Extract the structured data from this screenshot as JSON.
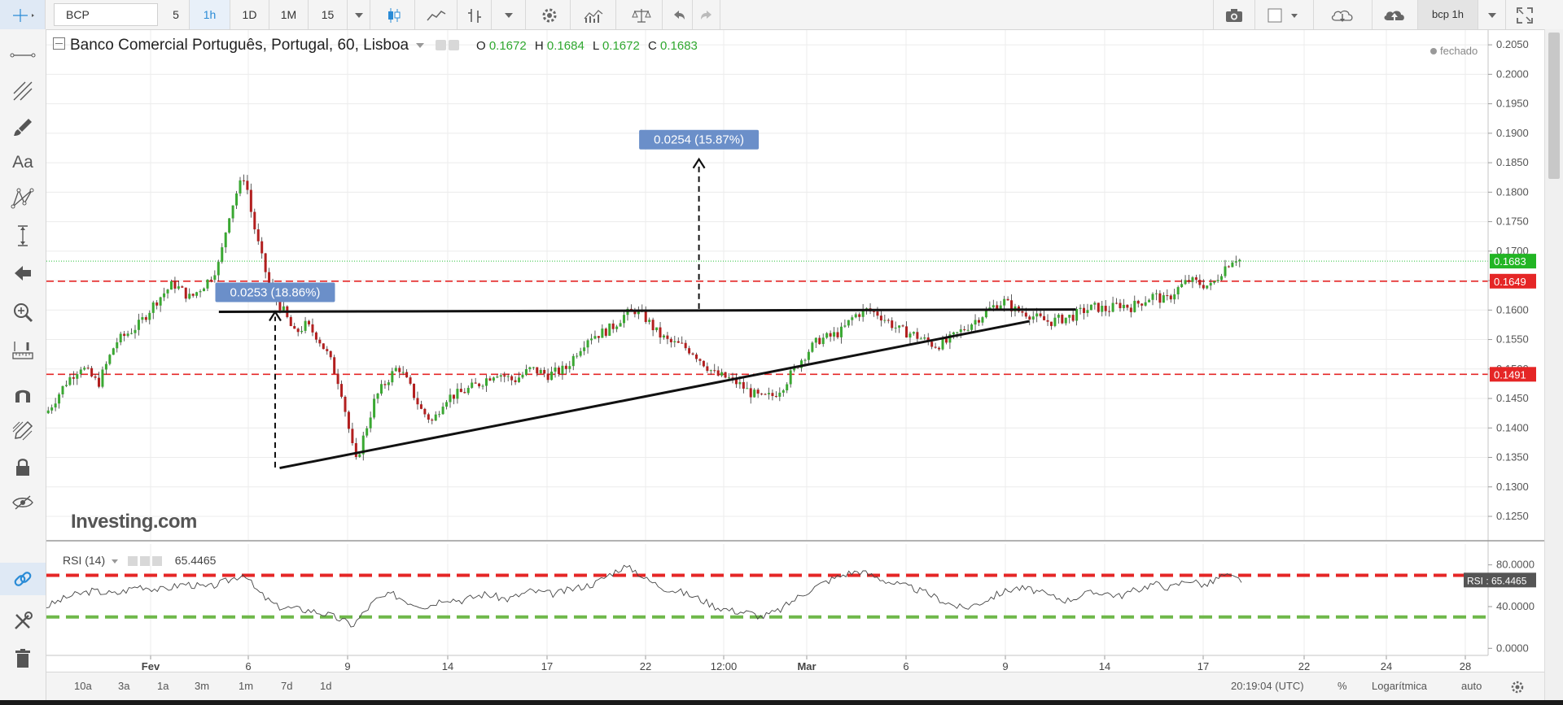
{
  "toolbar": {
    "symbol": "BCP",
    "intervals": [
      "5",
      "1h",
      "1D",
      "1M",
      "15"
    ],
    "active_interval": "1h",
    "layout_label": "bcp 1h"
  },
  "legend": {
    "title": "Banco Comercial Português, Portugal, 60, Lisboa",
    "o_label": "O",
    "o_value": "0.1672",
    "h_label": "H",
    "h_value": "0.1684",
    "l_label": "L",
    "l_value": "0.1672",
    "c_label": "C",
    "c_value": "0.1683",
    "status": "fechado",
    "watermark": "Investing.com"
  },
  "rsi": {
    "label": "RSI (14)",
    "value": "65.4465",
    "badge": "RSI : 65.4465"
  },
  "bottombar": {
    "ranges": [
      "10a",
      "3a",
      "1a",
      "3m",
      "1m",
      "7d",
      "1d"
    ],
    "time": "20:19:04",
    "tz": "(UTC)",
    "pct": "%",
    "log": "Logarítmica",
    "auto": "auto"
  },
  "colors": {
    "up": "#3aa832",
    "down": "#b21f1f",
    "price_line": "#29c13a",
    "resistance": "#e52626",
    "rsi_upper": "#e52626",
    "rsi_lower": "#6fb84a",
    "annotation_bg": "#6b8fc9"
  },
  "chart_data": {
    "type": "candlestick",
    "instrument": "Banco Comercial Português, Portugal, 60, Lisboa",
    "y_ticks": [
      "0.2050",
      "0.2000",
      "0.1950",
      "0.1900",
      "0.1850",
      "0.1800",
      "0.1750",
      "0.1700",
      "0.1650",
      "0.1600",
      "0.1550",
      "0.1500",
      "0.1450",
      "0.1400",
      "0.1350",
      "0.1300",
      "0.1250"
    ],
    "ylim": [
      0.121,
      0.2075
    ],
    "x_ticks": [
      "Fev",
      "6",
      "9",
      "14",
      "17",
      "22",
      "12:00",
      "Mar",
      "6",
      "9",
      "14",
      "17",
      "22",
      "24",
      "28"
    ],
    "last_price": "0.1683",
    "horizontal_levels": [
      {
        "label": "0.1649",
        "value": 0.1649
      },
      {
        "label": "0.1491",
        "value": 0.1491
      }
    ],
    "trendlines": [
      {
        "name": "resistance",
        "x1": 0.1495,
        "y1": 0.1597,
        "x2": 0.8925,
        "y2": 0.1601
      },
      {
        "name": "support",
        "x1": 0.2022,
        "y1": 0.1332,
        "x2": 0.852,
        "y2": 0.1581
      }
    ],
    "measures": [
      {
        "label": "0.0253 (18.86%)",
        "x": 0.1983,
        "from": 0.1333,
        "to": 0.1597
      },
      {
        "label": "0.0254 (15.87%)",
        "x": 0.5657,
        "from": 0.1602,
        "to": 0.1856
      }
    ],
    "price_path": [
      [
        0.0,
        0.1425
      ],
      [
        0.018,
        0.148
      ],
      [
        0.03,
        0.1505
      ],
      [
        0.045,
        0.1475
      ],
      [
        0.06,
        0.1545
      ],
      [
        0.08,
        0.1575
      ],
      [
        0.095,
        0.1615
      ],
      [
        0.11,
        0.1645
      ],
      [
        0.125,
        0.162
      ],
      [
        0.14,
        0.165
      ],
      [
        0.15,
        0.168
      ],
      [
        0.158,
        0.176
      ],
      [
        0.165,
        0.18
      ],
      [
        0.172,
        0.183
      ],
      [
        0.178,
        0.176
      ],
      [
        0.185,
        0.17
      ],
      [
        0.195,
        0.163
      ],
      [
        0.205,
        0.16
      ],
      [
        0.215,
        0.156
      ],
      [
        0.225,
        0.1575
      ],
      [
        0.235,
        0.1555
      ],
      [
        0.245,
        0.152
      ],
      [
        0.255,
        0.147
      ],
      [
        0.262,
        0.14
      ],
      [
        0.268,
        0.134
      ],
      [
        0.275,
        0.1385
      ],
      [
        0.285,
        0.145
      ],
      [
        0.295,
        0.148
      ],
      [
        0.305,
        0.1505
      ],
      [
        0.315,
        0.147
      ],
      [
        0.325,
        0.143
      ],
      [
        0.335,
        0.141
      ],
      [
        0.345,
        0.145
      ],
      [
        0.36,
        0.146
      ],
      [
        0.375,
        0.1475
      ],
      [
        0.39,
        0.1495
      ],
      [
        0.405,
        0.148
      ],
      [
        0.42,
        0.15
      ],
      [
        0.435,
        0.149
      ],
      [
        0.45,
        0.15
      ],
      [
        0.46,
        0.153
      ],
      [
        0.47,
        0.1555
      ],
      [
        0.48,
        0.156
      ],
      [
        0.49,
        0.157
      ],
      [
        0.5,
        0.159
      ],
      [
        0.51,
        0.16
      ],
      [
        0.52,
        0.1585
      ],
      [
        0.53,
        0.156
      ],
      [
        0.54,
        0.1545
      ],
      [
        0.55,
        0.154
      ],
      [
        0.56,
        0.153
      ],
      [
        0.57,
        0.151
      ],
      [
        0.58,
        0.149
      ],
      [
        0.59,
        0.1485
      ],
      [
        0.6,
        0.1475
      ],
      [
        0.61,
        0.146
      ],
      [
        0.62,
        0.145
      ],
      [
        0.63,
        0.1455
      ],
      [
        0.64,
        0.1475
      ],
      [
        0.65,
        0.1505
      ],
      [
        0.66,
        0.153
      ],
      [
        0.67,
        0.155
      ],
      [
        0.68,
        0.1555
      ],
      [
        0.69,
        0.1565
      ],
      [
        0.7,
        0.159
      ],
      [
        0.71,
        0.16
      ],
      [
        0.72,
        0.1595
      ],
      [
        0.73,
        0.158
      ],
      [
        0.74,
        0.1565
      ],
      [
        0.75,
        0.156
      ],
      [
        0.76,
        0.155
      ],
      [
        0.77,
        0.154
      ],
      [
        0.78,
        0.1545
      ],
      [
        0.79,
        0.156
      ],
      [
        0.8,
        0.1575
      ],
      [
        0.81,
        0.159
      ],
      [
        0.82,
        0.1605
      ],
      [
        0.83,
        0.1615
      ],
      [
        0.84,
        0.16
      ],
      [
        0.85,
        0.1595
      ],
      [
        0.86,
        0.1585
      ],
      [
        0.87,
        0.158
      ],
      [
        0.88,
        0.1585
      ],
      [
        0.89,
        0.159
      ],
      [
        0.9,
        0.16
      ],
      [
        0.91,
        0.1605
      ],
      [
        0.92,
        0.16
      ],
      [
        0.93,
        0.161
      ],
      [
        0.94,
        0.1605
      ],
      [
        0.95,
        0.1615
      ],
      [
        0.96,
        0.1625
      ],
      [
        0.97,
        0.1615
      ],
      [
        0.98,
        0.1635
      ],
      [
        0.99,
        0.165
      ],
      [
        1.0,
        0.1645
      ],
      [
        1.01,
        0.164
      ],
      [
        1.02,
        0.167
      ],
      [
        1.03,
        0.169
      ],
      [
        1.036,
        0.1683
      ]
    ],
    "rsi_series": {
      "name": "RSI (14)",
      "ticks": [
        "80.0000",
        "40.0000",
        "0.0000"
      ],
      "ylim": [
        -6,
        100
      ],
      "upper_band": 70,
      "lower_band": 30,
      "last": "65.4465",
      "points": [
        [
          0.0,
          40
        ],
        [
          0.02,
          50
        ],
        [
          0.04,
          55
        ],
        [
          0.06,
          52
        ],
        [
          0.08,
          60
        ],
        [
          0.1,
          56
        ],
        [
          0.12,
          62
        ],
        [
          0.14,
          58
        ],
        [
          0.16,
          66
        ],
        [
          0.172,
          72
        ],
        [
          0.18,
          58
        ],
        [
          0.19,
          48
        ],
        [
          0.2,
          40
        ],
        [
          0.215,
          38
        ],
        [
          0.23,
          36
        ],
        [
          0.245,
          32
        ],
        [
          0.258,
          26
        ],
        [
          0.266,
          22
        ],
        [
          0.275,
          34
        ],
        [
          0.285,
          46
        ],
        [
          0.3,
          52
        ],
        [
          0.315,
          44
        ],
        [
          0.33,
          40
        ],
        [
          0.345,
          48
        ],
        [
          0.36,
          46
        ],
        [
          0.38,
          52
        ],
        [
          0.4,
          47
        ],
        [
          0.42,
          55
        ],
        [
          0.44,
          52
        ],
        [
          0.46,
          58
        ],
        [
          0.475,
          62
        ],
        [
          0.49,
          72
        ],
        [
          0.5,
          78
        ],
        [
          0.51,
          75
        ],
        [
          0.52,
          66
        ],
        [
          0.535,
          58
        ],
        [
          0.55,
          54
        ],
        [
          0.565,
          48
        ],
        [
          0.58,
          40
        ],
        [
          0.595,
          36
        ],
        [
          0.61,
          34
        ],
        [
          0.62,
          30
        ],
        [
          0.635,
          36
        ],
        [
          0.65,
          48
        ],
        [
          0.665,
          58
        ],
        [
          0.68,
          66
        ],
        [
          0.695,
          72
        ],
        [
          0.705,
          74
        ],
        [
          0.72,
          68
        ],
        [
          0.735,
          62
        ],
        [
          0.75,
          58
        ],
        [
          0.765,
          52
        ],
        [
          0.78,
          44
        ],
        [
          0.795,
          38
        ],
        [
          0.81,
          44
        ],
        [
          0.825,
          52
        ],
        [
          0.84,
          58
        ],
        [
          0.855,
          56
        ],
        [
          0.87,
          50
        ],
        [
          0.885,
          46
        ],
        [
          0.9,
          52
        ],
        [
          0.915,
          54
        ],
        [
          0.93,
          50
        ],
        [
          0.945,
          56
        ],
        [
          0.96,
          62
        ],
        [
          0.975,
          58
        ],
        [
          0.99,
          66
        ],
        [
          1.005,
          60
        ],
        [
          1.02,
          70
        ],
        [
          1.036,
          65.4
        ]
      ]
    }
  }
}
